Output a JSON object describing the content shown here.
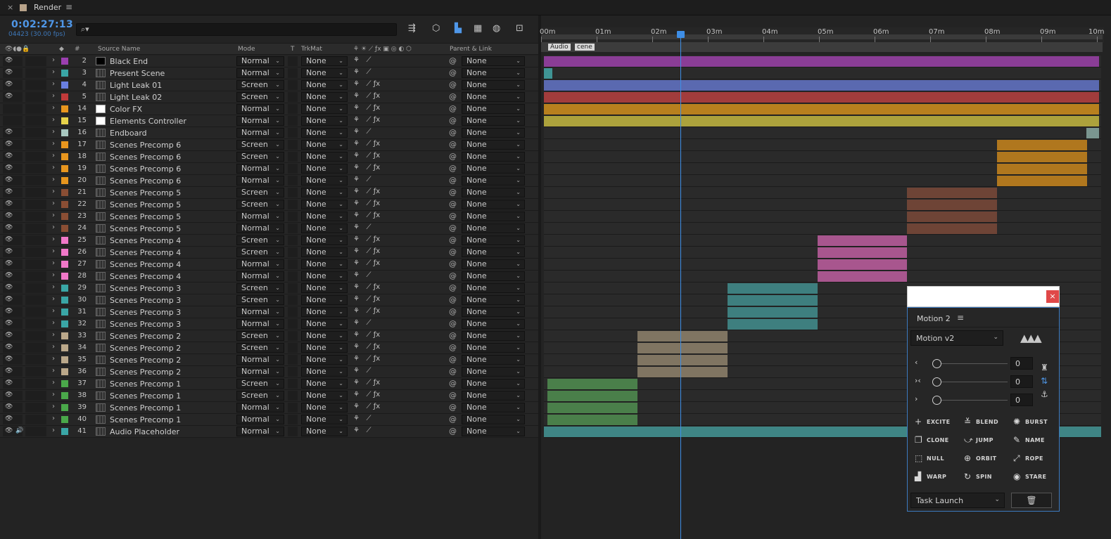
{
  "tab": {
    "close": "×",
    "title": "Render",
    "menu": "≡",
    "swatch": "#b8a38a"
  },
  "header": {
    "timecode": "0:02:27:13",
    "frames": "04423 (30.00 fps)",
    "search_icon": "search-icon"
  },
  "columns": {
    "num": "#",
    "source": "Source Name",
    "mode": "Mode",
    "t": "T",
    "trkmat": "TrkMat",
    "parent": "Parent & Link"
  },
  "layers": [
    {
      "num": "2",
      "name": "Black End",
      "mode": "Normal",
      "trk": "None",
      "parent": "None",
      "label": "#9b3fb0",
      "src": "solid-black",
      "vis": true,
      "fx": false,
      "bar": {
        "start": 0,
        "end": 789,
        "color": "#8a3d96"
      }
    },
    {
      "num": "3",
      "name": "Present Scene",
      "mode": "Normal",
      "trk": "None",
      "parent": "None",
      "label": "#3aa6a6",
      "src": "comp",
      "vis": true,
      "fx": false,
      "bar": {
        "start": 0,
        "end": 12,
        "color": "#3f9494"
      }
    },
    {
      "num": "4",
      "name": "Light Leak 01",
      "mode": "Screen",
      "trk": "None",
      "parent": "None",
      "label": "#6a7fe0",
      "src": "comp",
      "vis": true,
      "fx": true,
      "bar": {
        "start": 0,
        "end": 789,
        "color": "#5a69b0"
      }
    },
    {
      "num": "5",
      "name": "Light Leak 02",
      "mode": "Screen",
      "trk": "None",
      "parent": "None",
      "label": "#c03a3a",
      "src": "comp",
      "vis": true,
      "fx": true,
      "bar": {
        "start": 0,
        "end": 789,
        "color": "#a23c3c"
      }
    },
    {
      "num": "14",
      "name": "Color FX",
      "mode": "Normal",
      "trk": "None",
      "parent": "None",
      "label": "#e8961e",
      "src": "solid-white",
      "vis": false,
      "fx": true,
      "bar": {
        "start": 0,
        "end": 789,
        "color": "#b8801e"
      }
    },
    {
      "num": "15",
      "name": "Elements Controller",
      "mode": "Normal",
      "trk": "None",
      "parent": "None",
      "label": "#e6d24a",
      "src": "solid-white",
      "vis": false,
      "fx": true,
      "bar": {
        "start": 0,
        "end": 789,
        "color": "#aca23c"
      }
    },
    {
      "num": "16",
      "name": "Endboard",
      "mode": "Normal",
      "trk": "None",
      "parent": "None",
      "label": "#a8c8c0",
      "src": "comp",
      "vis": true,
      "fx": false,
      "bar": {
        "start": 771,
        "end": 789,
        "color": "#7a9690"
      }
    },
    {
      "num": "17",
      "name": "Scenes Precomp 6",
      "mode": "Screen",
      "trk": "None",
      "parent": "None",
      "label": "#e8961e",
      "src": "comp",
      "vis": true,
      "fx": true,
      "bar": {
        "start": 644,
        "end": 772,
        "color": "#b0771e"
      }
    },
    {
      "num": "18",
      "name": "Scenes Precomp 6",
      "mode": "Screen",
      "trk": "None",
      "parent": "None",
      "label": "#e8961e",
      "src": "comp",
      "vis": true,
      "fx": true,
      "bar": {
        "start": 644,
        "end": 772,
        "color": "#b0771e"
      }
    },
    {
      "num": "19",
      "name": "Scenes Precomp 6",
      "mode": "Normal",
      "trk": "None",
      "parent": "None",
      "label": "#e8961e",
      "src": "comp",
      "vis": true,
      "fx": true,
      "bar": {
        "start": 644,
        "end": 772,
        "color": "#b0771e"
      }
    },
    {
      "num": "20",
      "name": "Scenes Precomp 6",
      "mode": "Normal",
      "trk": "None",
      "parent": "None",
      "label": "#e8961e",
      "src": "comp",
      "vis": true,
      "fx": false,
      "bar": {
        "start": 644,
        "end": 772,
        "color": "#b0771e"
      }
    },
    {
      "num": "21",
      "name": "Scenes Precomp 5",
      "mode": "Screen",
      "trk": "None",
      "parent": "None",
      "label": "#8a4e34",
      "src": "comp",
      "vis": true,
      "fx": true,
      "bar": {
        "start": 516,
        "end": 644,
        "color": "#6e4436"
      }
    },
    {
      "num": "22",
      "name": "Scenes Precomp 5",
      "mode": "Screen",
      "trk": "None",
      "parent": "None",
      "label": "#8a4e34",
      "src": "comp",
      "vis": true,
      "fx": true,
      "bar": {
        "start": 516,
        "end": 644,
        "color": "#6e4436"
      }
    },
    {
      "num": "23",
      "name": "Scenes Precomp 5",
      "mode": "Normal",
      "trk": "None",
      "parent": "None",
      "label": "#8a4e34",
      "src": "comp",
      "vis": true,
      "fx": true,
      "bar": {
        "start": 516,
        "end": 644,
        "color": "#6e4436"
      }
    },
    {
      "num": "24",
      "name": "Scenes Precomp 5",
      "mode": "Normal",
      "trk": "None",
      "parent": "None",
      "label": "#8a4e34",
      "src": "comp",
      "vis": true,
      "fx": false,
      "bar": {
        "start": 516,
        "end": 644,
        "color": "#6e4436"
      }
    },
    {
      "num": "25",
      "name": "Scenes Precomp 4",
      "mode": "Screen",
      "trk": "None",
      "parent": "None",
      "label": "#f078c8",
      "src": "comp",
      "vis": true,
      "fx": true,
      "bar": {
        "start": 389,
        "end": 516,
        "color": "#a8568e"
      }
    },
    {
      "num": "26",
      "name": "Scenes Precomp 4",
      "mode": "Screen",
      "trk": "None",
      "parent": "None",
      "label": "#f078c8",
      "src": "comp",
      "vis": true,
      "fx": true,
      "bar": {
        "start": 389,
        "end": 516,
        "color": "#a8568e"
      }
    },
    {
      "num": "27",
      "name": "Scenes Precomp 4",
      "mode": "Normal",
      "trk": "None",
      "parent": "None",
      "label": "#f078c8",
      "src": "comp",
      "vis": true,
      "fx": true,
      "bar": {
        "start": 389,
        "end": 516,
        "color": "#a8568e"
      }
    },
    {
      "num": "28",
      "name": "Scenes Precomp 4",
      "mode": "Normal",
      "trk": "None",
      "parent": "None",
      "label": "#f078c8",
      "src": "comp",
      "vis": true,
      "fx": false,
      "bar": {
        "start": 389,
        "end": 516,
        "color": "#a8568e"
      }
    },
    {
      "num": "29",
      "name": "Scenes Precomp 3",
      "mode": "Screen",
      "trk": "None",
      "parent": "None",
      "label": "#3aa6a6",
      "src": "comp",
      "vis": true,
      "fx": true,
      "bar": {
        "start": 261,
        "end": 389,
        "color": "#3e7f7f"
      }
    },
    {
      "num": "30",
      "name": "Scenes Precomp 3",
      "mode": "Screen",
      "trk": "None",
      "parent": "None",
      "label": "#3aa6a6",
      "src": "comp",
      "vis": true,
      "fx": true,
      "bar": {
        "start": 261,
        "end": 389,
        "color": "#3e7f7f"
      }
    },
    {
      "num": "31",
      "name": "Scenes Precomp 3",
      "mode": "Normal",
      "trk": "None",
      "parent": "None",
      "label": "#3aa6a6",
      "src": "comp",
      "vis": true,
      "fx": true,
      "bar": {
        "start": 261,
        "end": 389,
        "color": "#3e7f7f"
      }
    },
    {
      "num": "32",
      "name": "Scenes Precomp 3",
      "mode": "Normal",
      "trk": "None",
      "parent": "None",
      "label": "#3aa6a6",
      "src": "comp",
      "vis": true,
      "fx": false,
      "bar": {
        "start": 261,
        "end": 389,
        "color": "#3e7f7f"
      }
    },
    {
      "num": "33",
      "name": "Scenes Precomp 2",
      "mode": "Screen",
      "trk": "None",
      "parent": "None",
      "label": "#bba88a",
      "src": "comp",
      "vis": true,
      "fx": true,
      "bar": {
        "start": 133,
        "end": 261,
        "color": "#807562"
      }
    },
    {
      "num": "34",
      "name": "Scenes Precomp 2",
      "mode": "Screen",
      "trk": "None",
      "parent": "None",
      "label": "#bba88a",
      "src": "comp",
      "vis": true,
      "fx": true,
      "bar": {
        "start": 133,
        "end": 261,
        "color": "#807562"
      }
    },
    {
      "num": "35",
      "name": "Scenes Precomp 2",
      "mode": "Normal",
      "trk": "None",
      "parent": "None",
      "label": "#bba88a",
      "src": "comp",
      "vis": true,
      "fx": true,
      "bar": {
        "start": 133,
        "end": 261,
        "color": "#807562"
      }
    },
    {
      "num": "36",
      "name": "Scenes Precomp 2",
      "mode": "Normal",
      "trk": "None",
      "parent": "None",
      "label": "#bba88a",
      "src": "comp",
      "vis": true,
      "fx": false,
      "bar": {
        "start": 133,
        "end": 261,
        "color": "#807562"
      }
    },
    {
      "num": "37",
      "name": "Scenes Precomp 1",
      "mode": "Screen",
      "trk": "None",
      "parent": "None",
      "label": "#4aa84a",
      "src": "comp",
      "vis": true,
      "fx": true,
      "bar": {
        "start": 5,
        "end": 133,
        "color": "#4a7f4a"
      }
    },
    {
      "num": "38",
      "name": "Scenes Precomp 1",
      "mode": "Screen",
      "trk": "None",
      "parent": "None",
      "label": "#4aa84a",
      "src": "comp",
      "vis": true,
      "fx": true,
      "bar": {
        "start": 5,
        "end": 133,
        "color": "#4a7f4a"
      }
    },
    {
      "num": "39",
      "name": "Scenes Precomp 1",
      "mode": "Normal",
      "trk": "None",
      "parent": "None",
      "label": "#4aa84a",
      "src": "comp",
      "vis": true,
      "fx": true,
      "bar": {
        "start": 5,
        "end": 133,
        "color": "#4a7f4a"
      }
    },
    {
      "num": "40",
      "name": "Scenes Precomp 1",
      "mode": "Normal",
      "trk": "None",
      "parent": "None",
      "label": "#4aa84a",
      "src": "comp",
      "vis": true,
      "fx": false,
      "bar": {
        "start": 5,
        "end": 133,
        "color": "#4a7f4a"
      }
    },
    {
      "num": "41",
      "name": "Audio Placeholder",
      "mode": "Normal",
      "trk": "None",
      "parent": "None",
      "label": "#3aa6a6",
      "src": "comp",
      "vis": true,
      "audio": true,
      "fx": false,
      "bar": {
        "start": 0,
        "end": 792,
        "color": "#3f8585"
      }
    }
  ],
  "ruler": {
    "labels": [
      "00m",
      "01m",
      "02m",
      "03m",
      "04m",
      "05m",
      "06m",
      "07m",
      "08m",
      "09m",
      "10m"
    ],
    "markers": [
      "Audio",
      "cene"
    ]
  },
  "motion": {
    "title": "Motion 2",
    "menu": "≡",
    "preset": "Motion v2",
    "sliders": [
      {
        "arrow": "‹",
        "value": "0"
      },
      {
        "arrow": "›‹",
        "value": "0"
      },
      {
        "arrow": "›",
        "value": "0"
      }
    ],
    "buttons": [
      {
        "label": "EXCITE",
        "icon": "+"
      },
      {
        "label": "BLEND",
        "icon": "≚"
      },
      {
        "label": "BURST",
        "icon": "✺"
      },
      {
        "label": "CLONE",
        "icon": "❐"
      },
      {
        "label": "JUMP",
        "icon": "⤻"
      },
      {
        "label": "NAME",
        "icon": "✎"
      },
      {
        "label": "NULL",
        "icon": "⬚"
      },
      {
        "label": "ORBIT",
        "icon": "⊕"
      },
      {
        "label": "ROPE",
        "icon": "⤢"
      },
      {
        "label": "WARP",
        "icon": "▟"
      },
      {
        "label": "SPIN",
        "icon": "↻"
      },
      {
        "label": "STARE",
        "icon": "◉"
      }
    ],
    "task": "Task Launch",
    "close": "×"
  }
}
